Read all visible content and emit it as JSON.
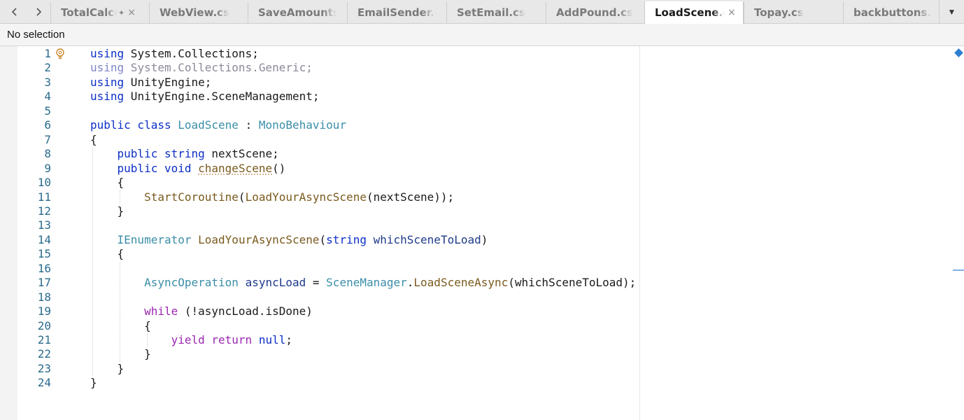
{
  "tabbar": {
    "back_icon": "chevron-left-icon",
    "forward_icon": "chevron-right-icon",
    "tabs": [
      {
        "label": "TotalCalculator.cs",
        "pinned": true,
        "active": false
      },
      {
        "label": "WebView.cs",
        "active": false
      },
      {
        "label": "SaveAmounts.cs",
        "active": false
      },
      {
        "label": "EmailSender.cs",
        "active": false
      },
      {
        "label": "SetEmail.cs",
        "active": false
      },
      {
        "label": "AddPound.cs",
        "active": false
      },
      {
        "label": "LoadScene.cs",
        "active": true
      },
      {
        "label": "Topay.cs",
        "active": false
      },
      {
        "label": "backbuttons.cs",
        "active": false
      }
    ],
    "pin_glyph": "✦",
    "close_glyph": "×",
    "overflow_icon": "chevron-down-icon",
    "overflow_glyph": "▼"
  },
  "status": {
    "selection": "No selection"
  },
  "editor": {
    "lightbulb_icon": "lightbulb-icon",
    "lines": [
      {
        "n": "1",
        "t": [
          [
            "kw",
            "using"
          ],
          [
            "txt",
            " System.Collections;"
          ]
        ]
      },
      {
        "n": "2",
        "t": [
          [
            "dimkw",
            "using"
          ],
          [
            "dim",
            " System.Collections.Generic;"
          ]
        ]
      },
      {
        "n": "3",
        "t": [
          [
            "kw",
            "using"
          ],
          [
            "txt",
            " UnityEngine;"
          ]
        ]
      },
      {
        "n": "4",
        "t": [
          [
            "kw",
            "using"
          ],
          [
            "txt",
            " UnityEngine.SceneManagement;"
          ]
        ]
      },
      {
        "n": "5",
        "t": []
      },
      {
        "n": "6",
        "t": [
          [
            "kw",
            "public class"
          ],
          [
            "txt",
            " "
          ],
          [
            "type",
            "LoadScene"
          ],
          [
            "txt",
            " : "
          ],
          [
            "type",
            "MonoBehaviour"
          ]
        ]
      },
      {
        "n": "7",
        "t": [
          [
            "txt",
            "{"
          ]
        ]
      },
      {
        "n": "8",
        "t": [
          [
            "txt",
            "    "
          ],
          [
            "kw",
            "public string"
          ],
          [
            "txt",
            " nextScene;"
          ]
        ]
      },
      {
        "n": "9",
        "t": [
          [
            "txt",
            "    "
          ],
          [
            "kw",
            "public void"
          ],
          [
            "txt",
            " "
          ],
          [
            "meth_sq",
            "changeScene"
          ],
          [
            "txt",
            "()"
          ]
        ]
      },
      {
        "n": "10",
        "t": [
          [
            "txt",
            "    {"
          ]
        ]
      },
      {
        "n": "11",
        "t": [
          [
            "txt",
            "        "
          ],
          [
            "meth",
            "StartCoroutine"
          ],
          [
            "txt",
            "("
          ],
          [
            "meth",
            "LoadYourAsyncScene"
          ],
          [
            "txt",
            "(nextScene));"
          ]
        ]
      },
      {
        "n": "12",
        "t": [
          [
            "txt",
            "    }"
          ]
        ]
      },
      {
        "n": "13",
        "t": []
      },
      {
        "n": "14",
        "t": [
          [
            "txt",
            "    "
          ],
          [
            "type",
            "IEnumerator"
          ],
          [
            "txt",
            " "
          ],
          [
            "meth",
            "LoadYourAsyncScene"
          ],
          [
            "txt",
            "("
          ],
          [
            "kw",
            "string"
          ],
          [
            "txt",
            " "
          ],
          [
            "var",
            "whichSceneToLoad"
          ],
          [
            "txt",
            ")"
          ]
        ]
      },
      {
        "n": "15",
        "t": [
          [
            "txt",
            "    {"
          ]
        ]
      },
      {
        "n": "16",
        "t": []
      },
      {
        "n": "17",
        "t": [
          [
            "txt",
            "        "
          ],
          [
            "type",
            "AsyncOperation"
          ],
          [
            "txt",
            " "
          ],
          [
            "var",
            "asyncLoad"
          ],
          [
            "txt",
            " = "
          ],
          [
            "type",
            "SceneManager"
          ],
          [
            "txt",
            "."
          ],
          [
            "meth",
            "LoadSceneAsync"
          ],
          [
            "txt",
            "(whichSceneToLoad);"
          ]
        ]
      },
      {
        "n": "18",
        "t": []
      },
      {
        "n": "19",
        "t": [
          [
            "txt",
            "        "
          ],
          [
            "kwp",
            "while"
          ],
          [
            "txt",
            " (!asyncLoad.isDone)"
          ]
        ]
      },
      {
        "n": "20",
        "t": [
          [
            "txt",
            "        {"
          ]
        ]
      },
      {
        "n": "21",
        "t": [
          [
            "txt",
            "            "
          ],
          [
            "kwp",
            "yield return"
          ],
          [
            "txt",
            " "
          ],
          [
            "kw",
            "null"
          ],
          [
            "txt",
            ";"
          ]
        ]
      },
      {
        "n": "22",
        "t": [
          [
            "txt",
            "        }"
          ]
        ]
      },
      {
        "n": "23",
        "t": [
          [
            "txt",
            "    }"
          ]
        ]
      },
      {
        "n": "24",
        "t": [
          [
            "txt",
            "}"
          ]
        ]
      }
    ]
  }
}
